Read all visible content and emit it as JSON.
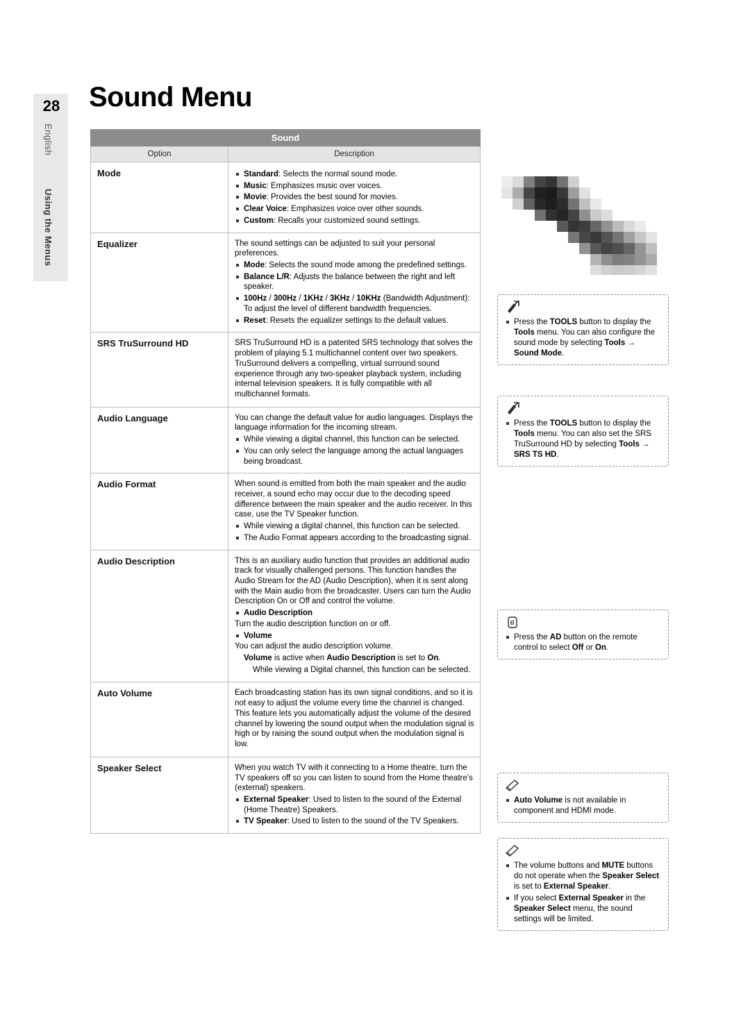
{
  "page": {
    "number": "28",
    "language_tab": "English",
    "section_tab": "Using the Menus",
    "title": "Sound Menu"
  },
  "table": {
    "title": "Sound",
    "headers": [
      "Option",
      "Description"
    ],
    "rows": [
      {
        "option": "Mode",
        "intro": "",
        "bullets": [
          "<b>Standard</b>: Selects the normal sound mode.",
          "<b>Music</b>: Emphasizes music over voices.",
          "<b>Movie</b>: Provides the best sound for movies.",
          "<b>Clear Voice</b>: Emphasizes voice over other sounds.",
          "<b>Custom</b>: Recalls your customized sound settings."
        ]
      },
      {
        "option": "Equalizer",
        "intro": "The sound settings can be adjusted to suit your personal preferences.",
        "bullets": [
          "<b>Mode</b>: Selects the sound mode among the predefined settings.",
          "<b>Balance L/R</b>: Adjusts the balance between the right and left speaker.",
          "<b>100Hz</b> / <b>300Hz</b> / <b>1KHz</b> / <b>3KHz</b> / <b>10KHz</b> (Bandwidth Adjustment): To adjust the level of different bandwidth frequencies.",
          "<b>Reset</b>: Resets the equalizer settings to the default values."
        ]
      },
      {
        "option": "SRS TruSurround HD",
        "intro": "SRS TruSurround HD is a patented SRS technology that solves the problem of playing 5.1 multichannel content over two speakers. TruSurround delivers a compelling, virtual surround sound experience through any two-speaker playback system, including internal television speakers. It is fully compatible with all multichannel formats.",
        "bullets": []
      },
      {
        "option": "Audio Language",
        "intro": "You can change the default value for audio languages. Displays the language information for the incoming stream.",
        "bullets": [
          "While viewing a digital channel, this function can be selected.",
          "You can only select the language among the actual languages being broadcast."
        ]
      },
      {
        "option": "Audio Format",
        "intro": "When sound is emitted from both the main speaker and the audio receiver, a sound echo may occur due to the decoding speed difference between the main speaker and the audio receiver. In this case, use the TV Speaker function.",
        "bullets": [
          "While viewing a digital channel, this function can be selected.",
          "The Audio Format appears according to the broadcasting signal."
        ]
      },
      {
        "option": "Audio Description",
        "intro": "This is an auxiliary audio function that provides an additional audio track for visually challenged persons. This function handles the Audio Stream for the AD (Audio Description), when it is sent along with the Main audio from the broadcaster. Users can turn the Audio Description On or Off and control the volume.",
        "bullets": [],
        "sub_sections": [
          {
            "heading": "Audio Description",
            "body": "Turn the audio description function on or off."
          },
          {
            "heading": "Volume",
            "body": "You can adjust the audio description volume.",
            "note": "<b>Volume</b> is active when <b>Audio Description</b> is set to <b>On</b>.",
            "note2": "While viewing a Digital channel, this function can be selected."
          }
        ]
      },
      {
        "option": "Auto Volume",
        "intro": "Each broadcasting station has its own signal conditions, and so it is not easy to adjust the volume every time the channel is changed. This feature lets you automatically adjust the volume of the desired channel by lowering the sound output when the modulation signal is high or by raising the sound output when the modulation signal is low.",
        "bullets": []
      },
      {
        "option": "Speaker Select",
        "intro": "When you watch TV with it connecting to a Home theatre, turn the TV speakers off so you can listen to sound from the Home theatre’s (external) speakers.",
        "bullets": [
          "<b>External Speaker</b>: Used to listen to the sound of the External (Home Theatre) Speakers.",
          "<b>TV Speaker</b>: Used to listen to the sound of the TV Speakers."
        ]
      }
    ]
  },
  "notes": [
    {
      "id": "note-tools-sound-mode",
      "icon": "tools-icon",
      "text": "Press the <b>TOOLS</b> button to display the <b>Tools</b> menu. You can also configure the sound mode by selecting <b>Tools</b> → <b>Sound Mode</b>."
    },
    {
      "id": "note-tools-srs",
      "icon": "tools-icon",
      "text": "Press the <b>TOOLS</b> button to display the <b>Tools</b> menu. You can also set the SRS TruSurround HD by selecting <b>Tools</b> → <b>SRS TS HD</b>."
    },
    {
      "id": "note-ad-button",
      "icon": "hand-press-icon",
      "text": "Press the <b>AD</b> button on the remote control to select <b>Off</b> or <b>On</b>."
    },
    {
      "id": "note-auto-volume",
      "icon": "pencil-note-icon",
      "text": "<b>Auto Volume</b> is not available in component and HDMI mode."
    },
    {
      "id": "note-speaker-select",
      "icon": "pencil-note-icon",
      "text": "The volume buttons and <b>MUTE</b> buttons do not operate when the <b>Speaker Select</b> is set to <b>External Speaker</b>.",
      "text2": "If you select <b>External Speaker</b> in the <b>Speaker Select</b> menu, the sound settings will be limited."
    }
  ]
}
